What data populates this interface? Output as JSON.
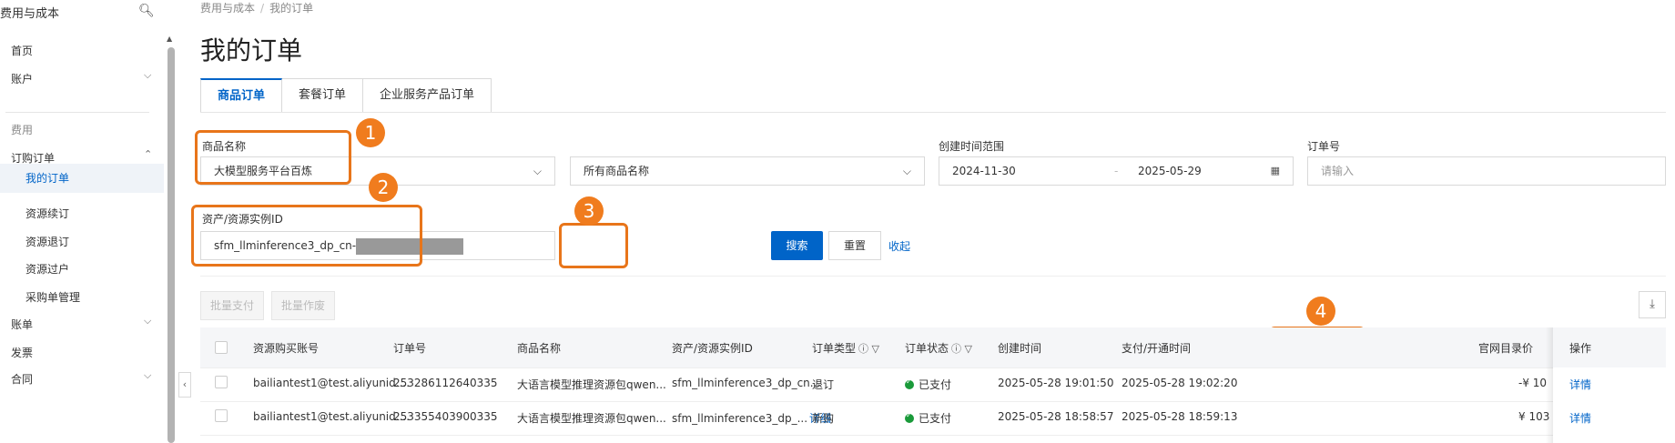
{
  "sidebar": {
    "title": "费用与成本",
    "items": [
      {
        "label": "首页"
      },
      {
        "label": "账户"
      },
      {
        "group": "费用"
      },
      {
        "label": "订购订单"
      },
      {
        "label": "我的订单"
      },
      {
        "label": "资源续订"
      },
      {
        "label": "资源退订"
      },
      {
        "label": "资源过户"
      },
      {
        "label": "采购单管理"
      },
      {
        "label": "账单"
      },
      {
        "label": "发票"
      },
      {
        "label": "合同"
      }
    ]
  },
  "breadcrumb": [
    "费用与成本",
    "我的订单"
  ],
  "page_title": "我的订单",
  "tabs": [
    {
      "label": "商品订单",
      "active": true
    },
    {
      "label": "套餐订单"
    },
    {
      "label": "企业服务产品订单"
    }
  ],
  "filters": {
    "product_name_label": "商品名称",
    "product_name_value": "大模型服务平台百炼",
    "product_all_value": "所有商品名称",
    "date_range_label": "创建时间范围",
    "date_start": "2024-11-30",
    "date_sep": "-",
    "date_end": "2025-05-29",
    "order_no_label": "订单号",
    "order_no_placeholder": "请输入",
    "instance_label": "资产/资源实例ID",
    "instance_value": "sfm_llminference3_dp_cn-",
    "search_label": "搜索",
    "reset_label": "重置",
    "collapse_label": "收起"
  },
  "annotations": [
    "1",
    "2",
    "3",
    "4"
  ],
  "actions": {
    "batch_pay": "批量支付",
    "batch_void": "批量作废"
  },
  "table": {
    "headers": [
      "资源购买账号",
      "订单号",
      "商品名称",
      "资产/资源实例ID",
      "订单类型",
      "订单状态",
      "创建时间",
      "支付/开通时间",
      "官网目录价",
      "操作"
    ],
    "rows": [
      {
        "account": "bailiantest1@test.aliyunid....",
        "order_no": "253286112640335",
        "product": "大语言模型推理资源包qwen...",
        "instance": "sfm_llminference3_dp_cn...",
        "instance_detail": "",
        "type": "退订",
        "status": "已支付",
        "created": "2025-05-28 19:01:50",
        "paid": "2025-05-28 19:02:20",
        "price": "-¥ 10",
        "action": "详情"
      },
      {
        "account": "bailiantest1@test.aliyunid....",
        "order_no": "253355403900335",
        "product": "大语言模型推理资源包qwen...",
        "instance": "sfm_llminference3_dp_...",
        "instance_detail": "详细",
        "type": "新购",
        "status": "已支付",
        "created": "2025-05-28 18:58:57",
        "paid": "2025-05-28 18:59:13",
        "price": "¥ 103",
        "action": "详情"
      }
    ]
  },
  "colors": {
    "accent": "#0064c8",
    "highlight": "#e8751a",
    "status_ok": "#1a9a3a"
  }
}
